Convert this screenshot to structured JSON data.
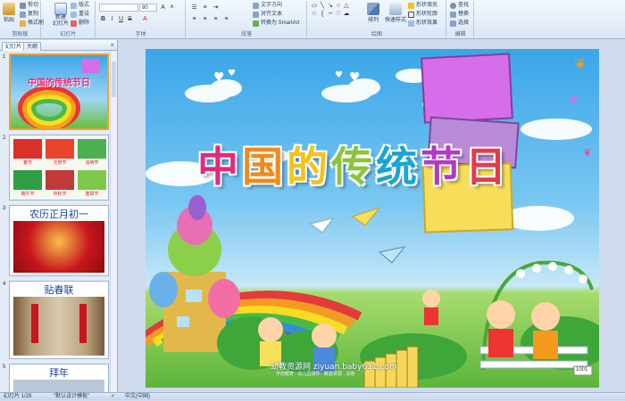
{
  "ribbon": {
    "clipboard": {
      "label": "剪贴板",
      "paste": "粘贴",
      "cut": "剪切",
      "copy": "复制",
      "format_painter": "格式刷"
    },
    "slides": {
      "label": "幻灯片",
      "new_slide": "新建\n幻灯片",
      "layout": "版式",
      "reset": "重设",
      "delete": "删除"
    },
    "font": {
      "label": "字体",
      "font_size": "80",
      "bold": "B",
      "italic": "I",
      "underline": "U",
      "strike": "S",
      "grow": "A",
      "shrink": "A"
    },
    "paragraph": {
      "label": "段落",
      "text_direction": "文字方向",
      "align_text": "对齐文本",
      "smartart": "转换为 SmartArt"
    },
    "drawing": {
      "label": "绘图",
      "arrange": "排列",
      "quick_styles": "快速样式",
      "shape_fill": "形状填充",
      "shape_outline": "形状轮廓",
      "shape_effects": "形状效果"
    },
    "editing": {
      "label": "编辑",
      "find": "查找",
      "replace": "替换",
      "select": "选择"
    }
  },
  "left_pane": {
    "tab_slides": "幻灯片",
    "tab_outline": "大纲",
    "close": "×",
    "thumbnails": [
      {
        "num": "1",
        "title": "中国的传统节日"
      },
      {
        "num": "2",
        "captions": [
          "春节",
          "元宵节",
          "清明节",
          "端午节",
          "中秋节",
          "重阳节"
        ]
      },
      {
        "num": "3",
        "title": "农历正月初一"
      },
      {
        "num": "4",
        "title": "贴春联"
      },
      {
        "num": "5",
        "title": "拜年"
      }
    ]
  },
  "slide": {
    "title_chars": [
      "中",
      "国",
      "的",
      "传",
      "统",
      "节",
      "日"
    ],
    "title_colors": [
      "#e4287a",
      "#f08a1c",
      "#f4c21a",
      "#8ac43a",
      "#1aa4d6",
      "#b03ac6",
      "#e63a4a"
    ],
    "watermark": "幼教资源网 ziyuan.baby611.com",
    "watermark_sub": "学前教育 · 幼儿园课件 · 教案资源 · 试卷",
    "bench_plate": "1001"
  },
  "status": {
    "slide_counter": "幻灯片 1/28",
    "theme": "\"默认设计模板\"",
    "language": "中文(中国)"
  },
  "colors": {
    "ribbon_bg": "#dbe6f5",
    "accent": "#f0a030",
    "pane_bg": "#e3ebf6"
  }
}
